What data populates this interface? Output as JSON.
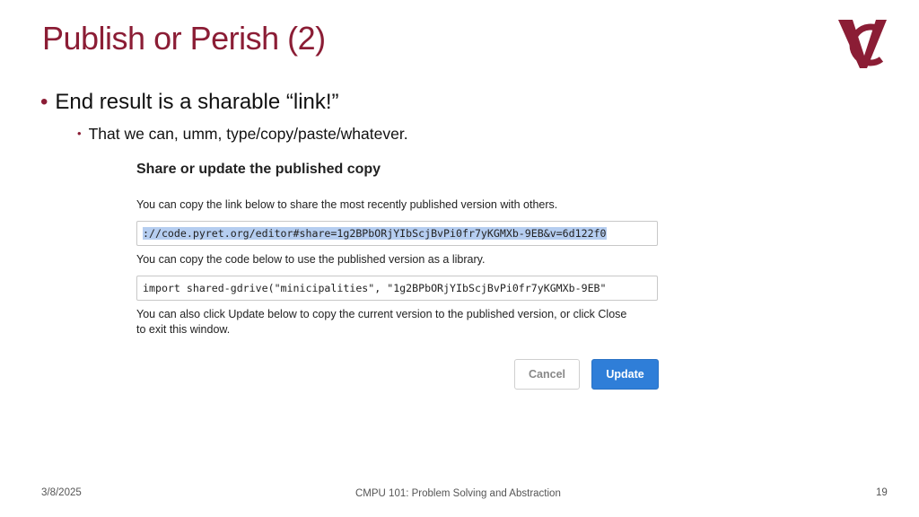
{
  "slide": {
    "title": "Publish or Perish (2)",
    "bullets": [
      "End result is a sharable “link!”",
      "That we can, umm, type/copy/paste/whatever."
    ]
  },
  "dialog": {
    "title": "Share or update the published copy",
    "link_instruction": "You can copy the link below to share the most recently published version with others.",
    "link_value": "://code.pyret.org/editor#share=1g2BPbORjYIbScjBvPi0fr7yKGMXb-9EB&v=6d122f0",
    "code_instruction": "You can copy the code below to use the published version as a library.",
    "code_value": "import shared-gdrive(\"minicipalities\", \"1g2BPbORjYIbScjBvPi0fr7yKGMXb-9EB\"",
    "update_instruction_line1": "You can also click Update below to copy the current version to the published version, or click Close",
    "update_instruction_line2": "to exit this window.",
    "cancel_label": "Cancel",
    "update_label": "Update"
  },
  "footer": {
    "date": "3/8/2025",
    "course": "CMPU 101: Problem Solving and Abstraction",
    "page_number": "19"
  },
  "colors": {
    "accent": "#8b1d35",
    "primary_button": "#2f7ed8",
    "selection": "#b5cdf0"
  },
  "icons": {
    "logo": "vassar-vc-logo"
  }
}
